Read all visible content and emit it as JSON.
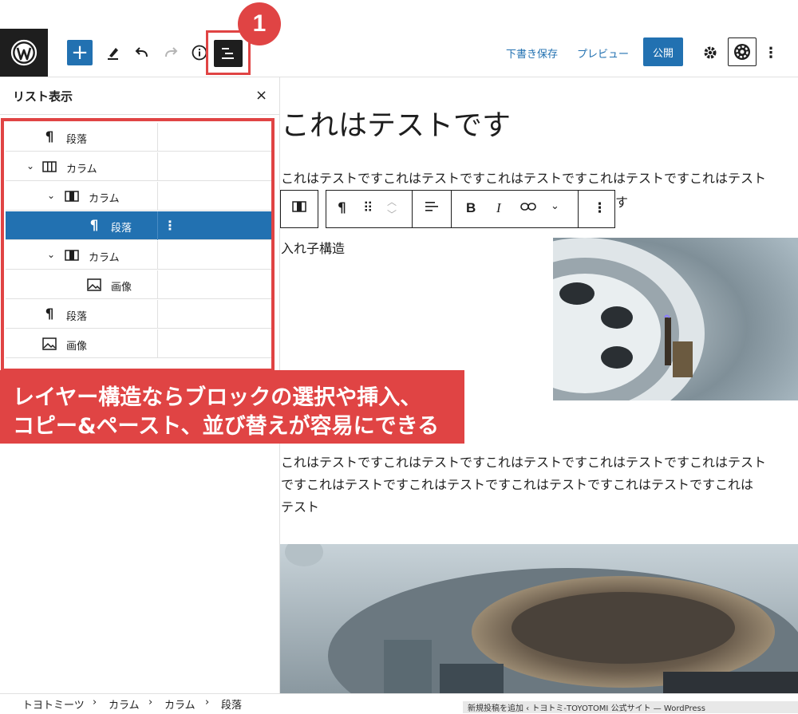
{
  "header": {
    "step_number": "1",
    "draft_label": "下書き保存",
    "preview_label": "プレビュー",
    "publish_label": "公開"
  },
  "sidebar": {
    "title": "リスト表示",
    "close": "×",
    "items": [
      {
        "label": "段落",
        "icon": "paragraph-icon",
        "selected": false
      },
      {
        "label": "カラム",
        "icon": "columns-icon",
        "selected": false
      },
      {
        "label": "カラム",
        "icon": "column-icon",
        "selected": false
      },
      {
        "label": "段落",
        "icon": "paragraph-icon",
        "selected": true
      },
      {
        "label": "カラム",
        "icon": "column-icon",
        "selected": false
      },
      {
        "label": "画像",
        "icon": "image-icon",
        "selected": false
      },
      {
        "label": "段落",
        "icon": "paragraph-icon",
        "selected": false
      },
      {
        "label": "画像",
        "icon": "image-icon",
        "selected": false
      }
    ]
  },
  "callout": {
    "line1": "レイヤー構造ならブロックの選択や挿入、",
    "line2": "コピー&ペースト、並び替えが容易にできる"
  },
  "editor": {
    "post_title": "これはテストです",
    "para1_line1": "これはテストですこれはテストですこれはテストですこれはテストですこれはテスト",
    "para1_tail": "す",
    "nested_label": "入れ子構造",
    "para2_line1": "これはテストですこれはテストですこれはテストですこれはテストですこれはテスト",
    "para2_line2": "ですこれはテストですこれはテストですこれはテストですこれはテストですこれは",
    "para2_line3": "テスト"
  },
  "footer": {
    "crumbs": [
      "トヨトミーツ",
      "カラム",
      "カラム",
      "段落"
    ],
    "separator": "›",
    "status_text": "新規投稿を追加 ‹ トヨトミ-TOYOTOMI 公式サイト — WordPress"
  },
  "colors": {
    "accent": "#2271b1",
    "highlight": "#e04444",
    "dark": "#1e1e1e"
  }
}
